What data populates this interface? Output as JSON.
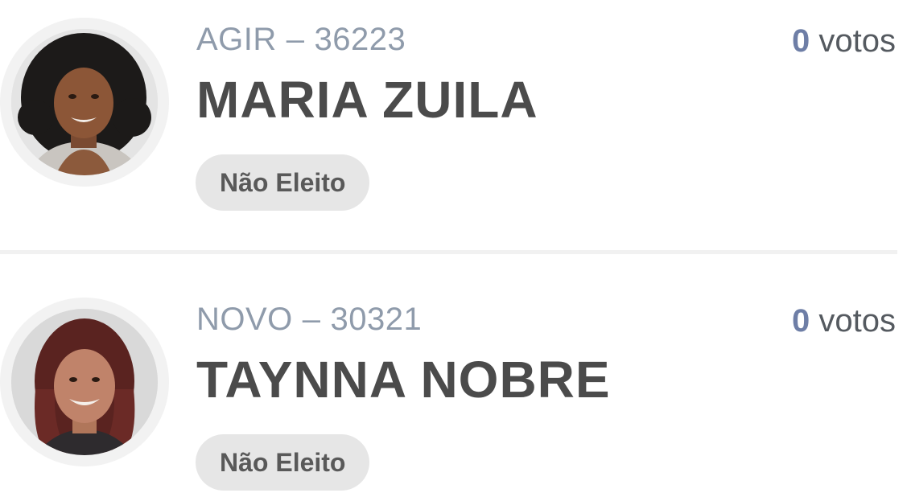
{
  "candidates": [
    {
      "party": "AGIR",
      "separator": "–",
      "number": "36223",
      "name": "MARIA ZUILA",
      "votes_count": "0",
      "votes_label": "votos",
      "status": "Não Eleito"
    },
    {
      "party": "NOVO",
      "separator": "–",
      "number": "30321",
      "name": "TAYNNA NOBRE",
      "votes_count": "0",
      "votes_label": "votos",
      "status": "Não Eleito"
    }
  ],
  "colors": {
    "party_text": "#8f9bab",
    "name_text": "#4b4b4b",
    "vote_count": "#6e7ea6",
    "badge_bg": "#e6e6e6"
  }
}
